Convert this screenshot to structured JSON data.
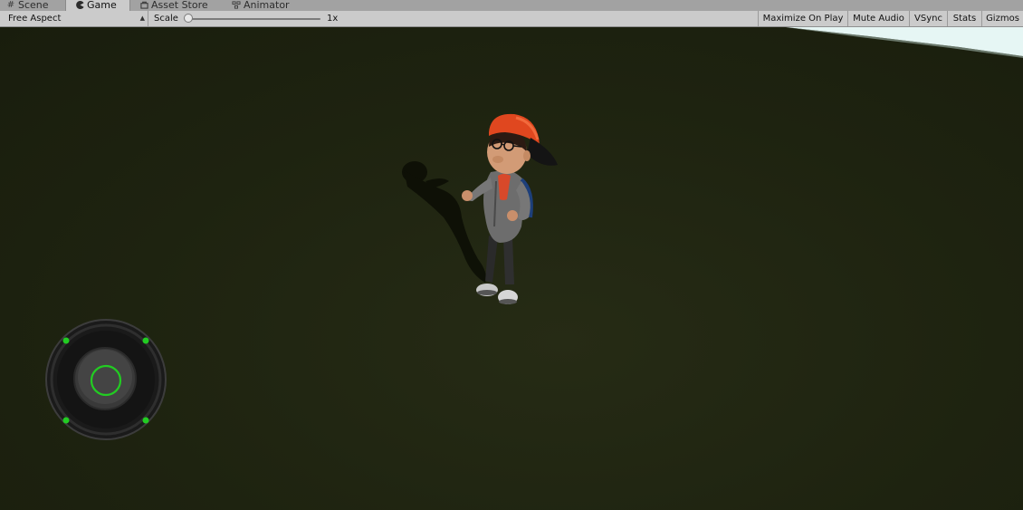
{
  "tabs": [
    {
      "label": "Scene",
      "icon": "grid-icon",
      "active": false
    },
    {
      "label": "Game",
      "icon": "pacman-icon",
      "active": true
    },
    {
      "label": "Asset Store",
      "icon": "store-icon",
      "active": false
    },
    {
      "label": "Animator",
      "icon": "animator-icon",
      "active": false
    }
  ],
  "toolbar": {
    "aspect": "Free Aspect",
    "scale_label": "Scale",
    "scale_value": "1x",
    "maximize_on_play": "Maximize On Play",
    "mute_audio": "Mute Audio",
    "vsync": "VSync",
    "stats": "Stats",
    "gizmos": "Gizmos"
  },
  "game": {
    "ground_color": "#1e2310",
    "sky_color": "#e4f4f2",
    "joystick_accent": "#22cc22"
  }
}
